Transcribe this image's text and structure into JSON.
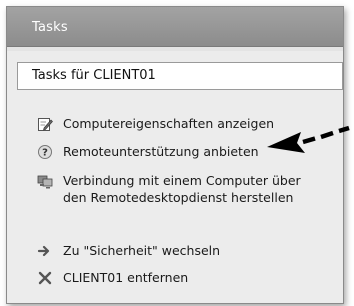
{
  "panel": {
    "title": "Tasks",
    "subheader": "Tasks für CLIENT01"
  },
  "tasks": [
    {
      "label": "Computereigenschaften anzeigen",
      "icon": "pencil-note-icon"
    },
    {
      "label": "Remoteunterstützung anbieten",
      "icon": "help-question-icon"
    },
    {
      "label": "Verbindung mit einem Computer über den Remotedesktopdienst herstellen",
      "icon": "remote-desktop-icon"
    },
    {
      "label": "Zu \"Sicherheit\" wechseln",
      "icon": "arrow-right-icon"
    },
    {
      "label": "CLIENT01 entfernen",
      "icon": "close-x-icon"
    }
  ],
  "colors": {
    "header": "#8c8c8c",
    "panel_bg": "#ececec",
    "arrow": "#000000"
  }
}
